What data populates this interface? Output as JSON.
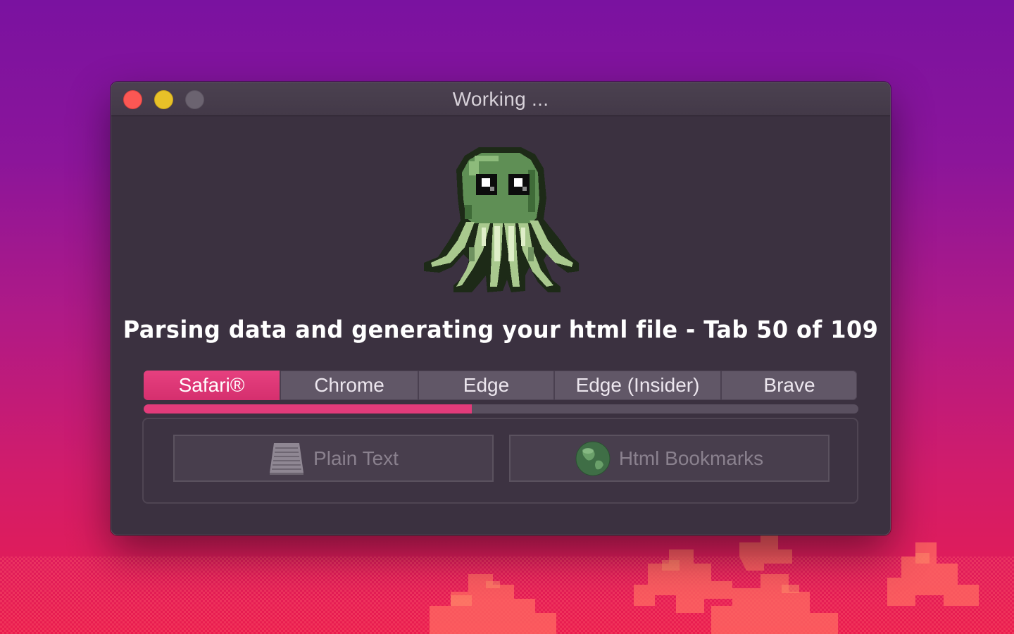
{
  "window": {
    "title": "Working ...",
    "status_text": "Parsing data and generating your html file - Tab 50 of 109"
  },
  "browsers": {
    "selected_index": 0,
    "items": [
      {
        "label": "Safari®"
      },
      {
        "label": "Chrome"
      },
      {
        "label": "Edge"
      },
      {
        "label": "Edge (Insider)"
      },
      {
        "label": "Brave"
      }
    ]
  },
  "progress": {
    "current": 50,
    "total": 109,
    "fraction": 0.4587
  },
  "export": {
    "plain_text_label": "Plain Text",
    "plain_text_icon": "text-document-icon",
    "html_bookmarks_label": "Html Bookmarks",
    "html_bookmarks_icon": "globe-icon",
    "enabled": false
  },
  "colors": {
    "accent": "#e23b7a",
    "window_bg": "#3b3140",
    "close": "#fb5754",
    "minimize": "#e8c128",
    "zoom_disabled": "#6b6370"
  }
}
